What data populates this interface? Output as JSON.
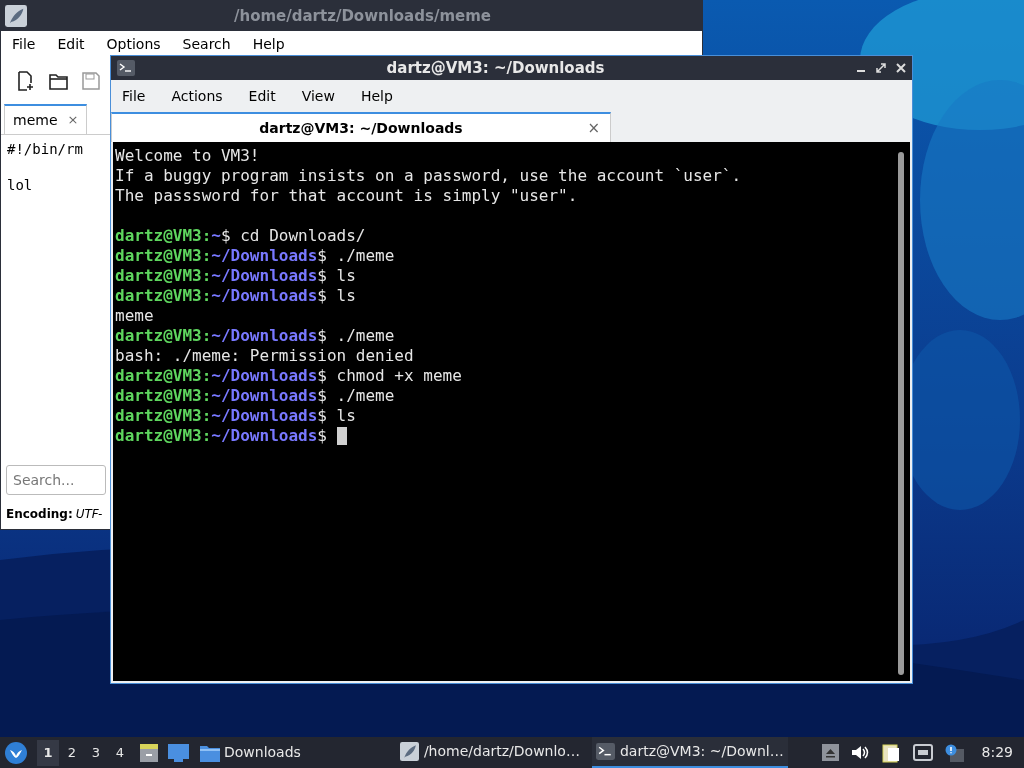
{
  "editor": {
    "title": "/home/dartz/Downloads/meme",
    "menu": [
      "File",
      "Edit",
      "Options",
      "Search",
      "Help"
    ],
    "tabs": [
      {
        "label": "meme",
        "close": "×",
        "selected": true
      }
    ],
    "lines": [
      {
        "kind": "text",
        "text": "#!/bin/rm"
      },
      {
        "kind": "blank"
      },
      {
        "kind": "text",
        "text": "lol"
      }
    ],
    "search": {
      "placeholder": "Search..."
    },
    "encoding": {
      "label": "Encoding:",
      "value": "UTF-"
    }
  },
  "terminal": {
    "title": "dartz@VM3: ~/Downloads",
    "menu": [
      "File",
      "Actions",
      "Edit",
      "View",
      "Help"
    ],
    "tabs": [
      {
        "label": "dartz@VM3: ~/Downloads",
        "close": "×",
        "selected": true
      }
    ],
    "lines": [
      {
        "kind": "output",
        "text": "Welcome to VM3!"
      },
      {
        "kind": "output",
        "text": "If a buggy program insists on a password, use the account `user`."
      },
      {
        "kind": "output",
        "text": "The passsword for that account is simply \"user\"."
      },
      {
        "kind": "blank"
      },
      {
        "kind": "prompt",
        "user": "dartz@VM3:",
        "path": "~",
        "command": "$ cd Downloads/"
      },
      {
        "kind": "prompt",
        "user": "dartz@VM3:",
        "path": "~/Downloads",
        "command": "$ ./meme"
      },
      {
        "kind": "prompt",
        "user": "dartz@VM3:",
        "path": "~/Downloads",
        "command": "$ ls"
      },
      {
        "kind": "prompt",
        "user": "dartz@VM3:",
        "path": "~/Downloads",
        "command": "$ ls"
      },
      {
        "kind": "output",
        "text": "meme"
      },
      {
        "kind": "prompt",
        "user": "dartz@VM3:",
        "path": "~/Downloads",
        "command": "$ ./meme"
      },
      {
        "kind": "output",
        "text": "bash: ./meme: Permission denied"
      },
      {
        "kind": "prompt",
        "user": "dartz@VM3:",
        "path": "~/Downloads",
        "command": "$ chmod +x meme"
      },
      {
        "kind": "prompt",
        "user": "dartz@VM3:",
        "path": "~/Downloads",
        "command": "$ ./meme"
      },
      {
        "kind": "prompt",
        "user": "dartz@VM3:",
        "path": "~/Downloads",
        "command": "$ ls"
      },
      {
        "kind": "prompt",
        "user": "dartz@VM3:",
        "path": "~/Downloads",
        "command": "$ ",
        "cursor": true
      }
    ]
  },
  "taskbar": {
    "workspaces": [
      {
        "label": "1",
        "selected": true
      },
      {
        "label": "2",
        "selected": false
      },
      {
        "label": "3",
        "selected": false
      },
      {
        "label": "4",
        "selected": false
      }
    ],
    "folder": "Downloads",
    "tasks": [
      {
        "kind": "editor",
        "label": "/home/dartz/Downlo…",
        "selected": false
      },
      {
        "kind": "terminal",
        "label": "dartz@VM3: ~/Downl…",
        "selected": true
      }
    ],
    "clock": "8:29"
  }
}
